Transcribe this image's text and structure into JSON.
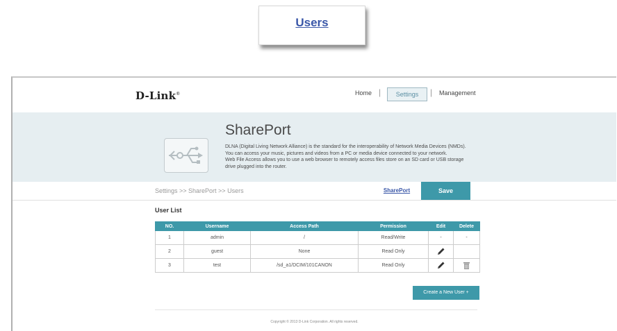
{
  "callout": {
    "label": "Users"
  },
  "header": {
    "logo": "D-Link",
    "logo_mark": "®",
    "nav": {
      "home": "Home",
      "settings": "Settings",
      "management": "Management",
      "separator": "|"
    }
  },
  "banner": {
    "title": "SharePort",
    "description": [
      "DLNA (Digital Living Network Alliance) is the standard for the interoperability of Network Media Devices (NMDs).",
      "You can access your music, pictures and videos from a PC or media device connected to your network.",
      "Web File Access allows you to use a web browser to remotely access files store on an SD card or USB storage",
      "drive plugged into the router."
    ]
  },
  "breadcrumb": "Settings >> SharePort >> Users",
  "sharePort_link": "SharePort",
  "save_label": "Save",
  "user_list": {
    "title": "User List",
    "columns": [
      "NO.",
      "Username",
      "Access Path",
      "Permission",
      "Edit",
      "Delete"
    ],
    "rows": [
      {
        "no": "1",
        "username": "admin",
        "path": "/",
        "permission": "Read/Write",
        "edit": "-",
        "delete": "-"
      },
      {
        "no": "2",
        "username": "guest",
        "path": "None",
        "permission": "Read Only",
        "edit": "pencil-icon",
        "delete": ""
      },
      {
        "no": "3",
        "username": "test",
        "path": "/sd_a1/DCIM/101CANON",
        "permission": "Read Only",
        "edit": "pencil-icon",
        "delete": "trash-icon"
      }
    ]
  },
  "create_button": "Create a New User +",
  "copyright": "Copyright © 2013 D-Link Corporation. All rights reserved.",
  "colors": {
    "accent": "#3e99a9",
    "link": "#3a57a8",
    "banner_bg": "#e6eef1"
  }
}
